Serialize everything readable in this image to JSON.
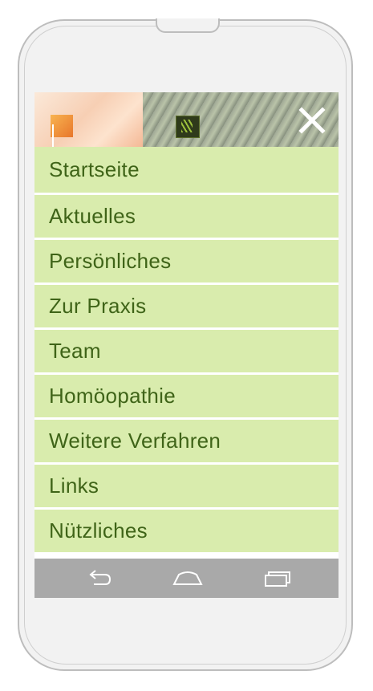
{
  "menu": {
    "items": [
      "Startseite",
      "Aktuelles",
      "Persönliches",
      "Zur Praxis",
      "Team",
      "Homöopathie",
      "Weitere Verfahren",
      "Links",
      "Nützliches"
    ]
  },
  "icons": {
    "close": "close-icon",
    "back": "back-icon",
    "home": "home-icon",
    "recents": "recent-apps-icon"
  },
  "colors": {
    "menu_bg": "#d9ecad",
    "menu_text": "#3f6418",
    "navbar_bg": "#a9a9a9"
  }
}
